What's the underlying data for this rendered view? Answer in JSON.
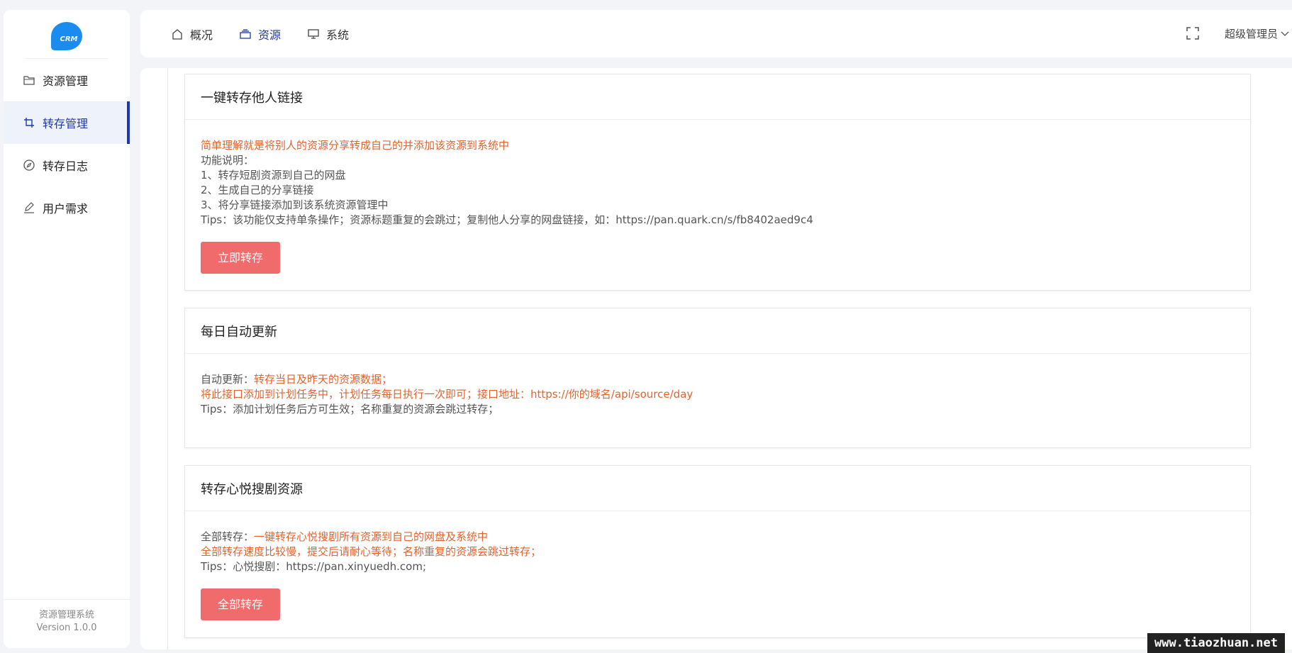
{
  "sidebar": {
    "logo_text": "CRM",
    "items": [
      {
        "label": "资源管理",
        "icon": "folder-icon"
      },
      {
        "label": "转存管理",
        "icon": "crop-icon",
        "active": true
      },
      {
        "label": "转存日志",
        "icon": "compass-icon"
      },
      {
        "label": "用户需求",
        "icon": "pen-icon"
      }
    ],
    "footer_title": "资源管理系统",
    "footer_version": "Version 1.0.0"
  },
  "header": {
    "nav": [
      {
        "label": "概况",
        "icon": "home-icon"
      },
      {
        "label": "资源",
        "icon": "stack-icon",
        "active": true
      },
      {
        "label": "系统",
        "icon": "monitor-icon"
      }
    ],
    "user": "超级管理员"
  },
  "cards": {
    "transfer": {
      "title": "一键转存他人链接",
      "intro": "简单理解就是将别人的资源分享转成自己的并添加该资源到系统中",
      "func_label": "功能说明：",
      "line1": "1、转存短剧资源到自己的网盘",
      "line2": "2、生成自己的分享链接",
      "line3": "3、将分享链接添加到该系统资源管理中",
      "tips": "Tips：该功能仅支持单条操作；资源标题重复的会跳过；复制他人分享的网盘链接，如：https://pan.quark.cn/s/fb8402aed9c4",
      "button": "立即转存"
    },
    "daily": {
      "title": "每日自动更新",
      "auto_label": "自动更新：",
      "auto_value": "转存当日及昨天的资源数据；",
      "line2": "将此接口添加到计划任务中，计划任务每日执行一次即可；接口地址：https://你的域名/api/source/day",
      "tips": "Tips：添加计划任务后方可生效；名称重复的资源会跳过转存；"
    },
    "xinyue": {
      "title": "转存心悦搜剧资源",
      "all_label": "全部转存：",
      "all_value": "一键转存心悦搜剧所有资源到自己的网盘及系统中",
      "line2": "全部转存速度比较慢，提交后请耐心等待；名称重复的资源会跳过转存；",
      "tips": "Tips：心悦搜剧：https://pan.xinyuedh.com;",
      "button": "全部转存"
    }
  },
  "watermark": "www.tiaozhuan.net"
}
